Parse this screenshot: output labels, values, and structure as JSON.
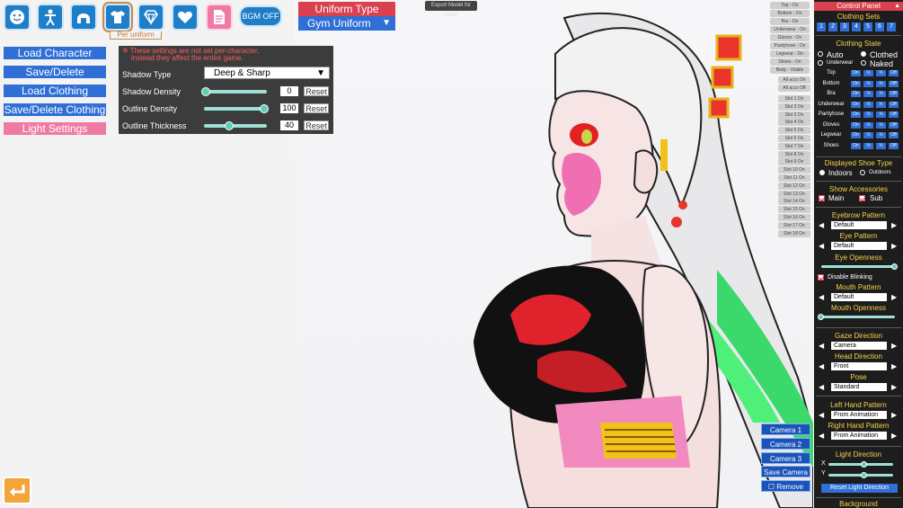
{
  "toolbar": {
    "icons": [
      "face-icon",
      "body-icon",
      "hair-icon",
      "clothing-icon",
      "accessory-icon",
      "heart-icon",
      "document-icon"
    ],
    "per_uniform_label": "Per uniform",
    "bgm_label": "BGM OFF"
  },
  "uniform": {
    "type_label": "Uniform Type",
    "selected": "Gym Uniform"
  },
  "export_button": "Export Model for KKBP",
  "left_menu": {
    "load_character": "Load Character",
    "save_delete_character": "Save/Delete Character",
    "load_clothing": "Load Clothing",
    "save_delete_clothing": "Save/Delete Clothing",
    "light_settings": "Light Settings"
  },
  "light_panel": {
    "notice_line1": "※ These settings are not set per-character,",
    "notice_line2": "instead they affect the entire game.",
    "shadow_type_label": "Shadow Type",
    "shadow_type_value": "Deep & Sharp",
    "shadow_density_label": "Shadow Density",
    "shadow_density_value": "0",
    "outline_density_label": "Outline Density",
    "outline_density_value": "100",
    "outline_thickness_label": "Outline Thickness",
    "outline_thickness_value": "40",
    "reset_label": "Reset"
  },
  "clothing_toggles": [
    "Top - On",
    "Bottom - On",
    "Bra - On",
    "Underwear - On",
    "Gloves - On",
    "Pantyhose - On",
    "Legwear - On",
    "Shoes - On",
    "Body - Visible"
  ],
  "accessory_toggles": [
    "All accs On",
    "All accs Off"
  ],
  "slot_toggles": [
    "Slot 1 On",
    "Slot 2 On",
    "Slot 3 On",
    "Slot 4 On",
    "Slot 5 On",
    "Slot 6 On",
    "Slot 7 On",
    "Slot 8 On",
    "Slot 9 On",
    "Slot 10 On",
    "Slot 11 On",
    "Slot 12 On",
    "Slot 13 On",
    "Slot 14 On",
    "Slot 15 On",
    "Slot 16 On",
    "Slot 17 On",
    "Slot 18 On"
  ],
  "camera": {
    "camera1": "Camera 1",
    "camera2": "Camera 2",
    "camera3": "Camera 3",
    "save": "Save Camera",
    "remove": "Remove"
  },
  "control_panel": {
    "title": "Control Panel",
    "clothing_sets_title": "Clothing Sets",
    "clothing_sets": [
      "1",
      "2",
      "3",
      "4",
      "5",
      "6",
      "7"
    ],
    "clothing_state_title": "Clothing State",
    "auto_label": "Auto",
    "clothed_label": "Clothed",
    "underwear_label": "Underwear",
    "naked_label": "Naked",
    "state_rows": [
      "Top",
      "Bottom",
      "Bra",
      "Underwear",
      "Pantyhose",
      "Gloves",
      "Legwear",
      "Shoes"
    ],
    "state_cells": [
      "On",
      "½",
      "½",
      "Off"
    ],
    "shoe_type_title": "Displayed Shoe Type",
    "indoors_label": "Indoors",
    "outdoors_label": "Outdoors",
    "show_accessories_title": "Show Accessories",
    "main_label": "Main",
    "sub_label": "Sub",
    "eyebrow_title": "Eyebrow Pattern",
    "eyebrow_value": "Default",
    "eye_title": "Eye Pattern",
    "eye_value": "Default",
    "eye_openness_title": "Eye Openness",
    "eye_openness": 1.0,
    "disable_blinking_label": "Disable Blinking",
    "mouth_title": "Mouth Pattern",
    "mouth_value": "Default",
    "mouth_openness_title": "Mouth Openness",
    "mouth_openness": 0.0,
    "gaze_title": "Gaze Direction",
    "gaze_value": "Camera",
    "head_title": "Head Direction",
    "head_value": "Front",
    "pose_title": "Pose",
    "pose_value": "Standard",
    "left_hand_title": "Left Hand Pattern",
    "left_hand_value": "From Animation",
    "right_hand_title": "Right Hand Pattern",
    "right_hand_value": "From Animation",
    "light_direction_title": "Light Direction",
    "x_label": "X",
    "y_label": "Y",
    "reset_light_label": "Reset Light Direction",
    "background_title": "Background"
  },
  "colors": {
    "blue": "#2f6fd6",
    "pink": "#f07aa6",
    "red": "#d9414f",
    "accent_teal": "#5fcfb6"
  }
}
